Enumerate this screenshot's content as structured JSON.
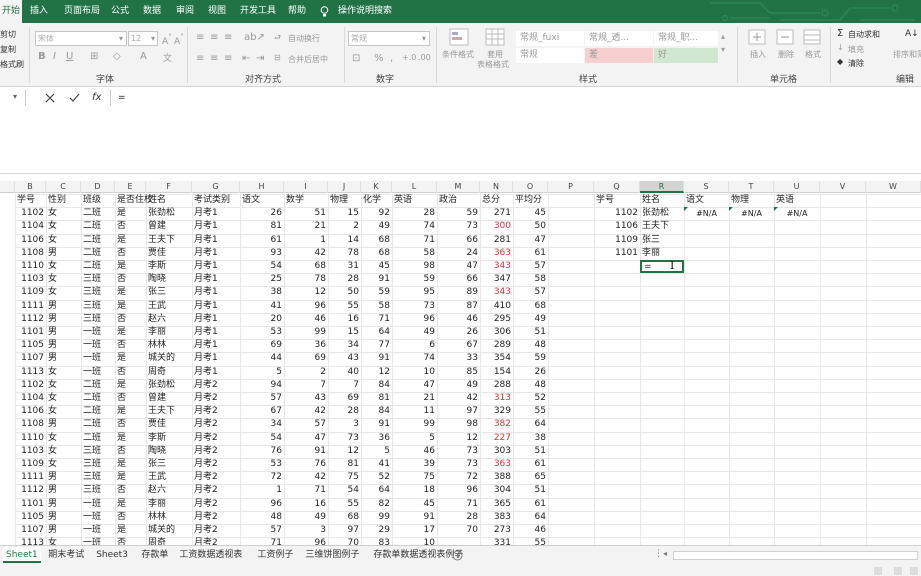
{
  "ribbon_tabs": [
    {
      "label": "开始",
      "active": true
    },
    {
      "label": "插入"
    },
    {
      "label": "页面布局"
    },
    {
      "label": "公式"
    },
    {
      "label": "数据"
    },
    {
      "label": "审阅"
    },
    {
      "label": "视图"
    },
    {
      "label": "开发工具"
    },
    {
      "label": "帮助"
    },
    {
      "label": "操作说明搜索"
    }
  ],
  "clipboard": {
    "cut": "剪切",
    "copy": "复制",
    "painter": "格式刷"
  },
  "font": {
    "name": "宋体",
    "size": "12",
    "group_label": "字体"
  },
  "alignment": {
    "wrap": "自动换行",
    "merge": "合并后居中",
    "group_label": "对齐方式"
  },
  "number": {
    "format": "常规",
    "group_label": "数字"
  },
  "styles": {
    "conditional": "条件格式",
    "table_format_1": "套用",
    "table_format_2": "表格格式",
    "cells": [
      "常规_fuxi",
      "常规_透...",
      "常规_职...",
      "常规",
      "差",
      "好"
    ],
    "group_label": "样式"
  },
  "cells_group": {
    "insert": "插入",
    "delete": "删除",
    "format": "格式",
    "group_label": "单元格"
  },
  "editing": {
    "autosum": "自动求和",
    "fill": "填充",
    "clear": "清除",
    "sort": "排序和筛",
    "group_label": "编辑"
  },
  "formula_bar": {
    "fx": "fx",
    "value": "="
  },
  "columns": [
    "B",
    "C",
    "D",
    "E",
    "F",
    "G",
    "H",
    "I",
    "J",
    "K",
    "L",
    "M",
    "N",
    "O",
    "P",
    "Q",
    "R",
    "S",
    "T",
    "U",
    "V",
    "W"
  ],
  "headers": [
    "学号",
    "性别",
    "班级",
    "是否住校",
    "姓名",
    "考试类别",
    "语文",
    "数学",
    "物理",
    "化学",
    "英语",
    "政治",
    "总分",
    "平均分"
  ],
  "rows": [
    [
      "1102",
      "女",
      "二班",
      "是",
      "张劲松",
      "月考1",
      "26",
      "51",
      "15",
      "92",
      "28",
      "59",
      "271",
      "45"
    ],
    [
      "1104",
      "女",
      "二班",
      "否",
      "曾建",
      "月考1",
      "81",
      "21",
      "2",
      "49",
      "74",
      "73",
      "300",
      "50"
    ],
    [
      "1106",
      "女",
      "二班",
      "是",
      "王夫下",
      "月考1",
      "61",
      "1",
      "14",
      "68",
      "71",
      "66",
      "281",
      "47"
    ],
    [
      "1108",
      "男",
      "二班",
      "否",
      "贾佳",
      "月考1",
      "93",
      "42",
      "78",
      "68",
      "58",
      "24",
      "363",
      "61"
    ],
    [
      "1110",
      "女",
      "二班",
      "是",
      "李斯",
      "月考1",
      "54",
      "68",
      "31",
      "45",
      "98",
      "47",
      "343",
      "57"
    ],
    [
      "1103",
      "女",
      "三班",
      "否",
      "陶晓",
      "月考1",
      "25",
      "78",
      "28",
      "91",
      "59",
      "66",
      "347",
      "58"
    ],
    [
      "1109",
      "女",
      "三班",
      "是",
      "张三",
      "月考1",
      "38",
      "12",
      "50",
      "59",
      "95",
      "89",
      "343",
      "57"
    ],
    [
      "1111",
      "男",
      "三班",
      "是",
      "王武",
      "月考1",
      "41",
      "96",
      "55",
      "58",
      "73",
      "87",
      "410",
      "68"
    ],
    [
      "1112",
      "男",
      "三班",
      "否",
      "赵六",
      "月考1",
      "20",
      "46",
      "16",
      "71",
      "96",
      "46",
      "295",
      "49"
    ],
    [
      "1101",
      "男",
      "一班",
      "是",
      "李丽",
      "月考1",
      "53",
      "99",
      "15",
      "64",
      "49",
      "26",
      "306",
      "51"
    ],
    [
      "1105",
      "男",
      "一班",
      "否",
      "林林",
      "月考1",
      "69",
      "36",
      "34",
      "77",
      "6",
      "67",
      "289",
      "48"
    ],
    [
      "1107",
      "男",
      "一班",
      "是",
      "城关的",
      "月考1",
      "44",
      "69",
      "43",
      "91",
      "74",
      "33",
      "354",
      "59"
    ],
    [
      "1113",
      "女",
      "一班",
      "否",
      "周奇",
      "月考1",
      "5",
      "2",
      "40",
      "12",
      "10",
      "85",
      "154",
      "26"
    ],
    [
      "1102",
      "女",
      "二班",
      "是",
      "张劲松",
      "月考2",
      "94",
      "7",
      "7",
      "84",
      "47",
      "49",
      "288",
      "48"
    ],
    [
      "1104",
      "女",
      "二班",
      "否",
      "曾建",
      "月考2",
      "57",
      "43",
      "69",
      "81",
      "21",
      "42",
      "313",
      "52"
    ],
    [
      "1106",
      "女",
      "二班",
      "是",
      "王夫下",
      "月考2",
      "67",
      "42",
      "28",
      "84",
      "11",
      "97",
      "329",
      "55"
    ],
    [
      "1108",
      "男",
      "二班",
      "否",
      "贾佳",
      "月考2",
      "34",
      "57",
      "3",
      "91",
      "99",
      "98",
      "382",
      "64"
    ],
    [
      "1110",
      "女",
      "二班",
      "是",
      "李斯",
      "月考2",
      "54",
      "47",
      "73",
      "36",
      "5",
      "12",
      "227",
      "38"
    ],
    [
      "1103",
      "女",
      "三班",
      "否",
      "陶晓",
      "月考2",
      "76",
      "91",
      "12",
      "5",
      "46",
      "73",
      "303",
      "51"
    ],
    [
      "1109",
      "女",
      "三班",
      "是",
      "张三",
      "月考2",
      "53",
      "76",
      "81",
      "41",
      "39",
      "73",
      "363",
      "61"
    ],
    [
      "1111",
      "男",
      "三班",
      "是",
      "王武",
      "月考2",
      "72",
      "42",
      "75",
      "52",
      "75",
      "72",
      "388",
      "65"
    ],
    [
      "1112",
      "男",
      "三班",
      "否",
      "赵六",
      "月考2",
      "1",
      "71",
      "54",
      "64",
      "18",
      "96",
      "304",
      "51"
    ],
    [
      "1101",
      "男",
      "一班",
      "是",
      "李丽",
      "月考2",
      "96",
      "16",
      "55",
      "82",
      "45",
      "71",
      "365",
      "61"
    ],
    [
      "1105",
      "男",
      "一班",
      "否",
      "林林",
      "月考2",
      "48",
      "49",
      "68",
      "99",
      "91",
      "28",
      "383",
      "64"
    ],
    [
      "1107",
      "男",
      "一班",
      "是",
      "城关的",
      "月考2",
      "57",
      "3",
      "97",
      "29",
      "17",
      "70",
      "273",
      "46"
    ],
    [
      "1113",
      "女",
      "一班",
      "否",
      "周奇",
      "月考2",
      "71",
      "96",
      "70",
      "83",
      "10",
      "",
      "331",
      "55"
    ]
  ],
  "red_totals": [
    "300",
    "363",
    "343",
    "313",
    "382",
    "227"
  ],
  "lookup": {
    "headers": [
      "学号",
      "姓名",
      "语文",
      "物理",
      "英语"
    ],
    "rows": [
      [
        "1102",
        "张劲松",
        "#N/A",
        "#N/A",
        "#N/A"
      ],
      [
        "1106",
        "王夫下",
        "",
        "",
        ""
      ],
      [
        "1109",
        "张三",
        "",
        "",
        ""
      ],
      [
        "1101",
        "李丽",
        "",
        "",
        ""
      ]
    ],
    "active_value": "="
  },
  "sheets": [
    {
      "label": "Sheet1",
      "active": true
    },
    {
      "label": "期末考试"
    },
    {
      "label": "Sheet3"
    },
    {
      "label": "存款单"
    },
    {
      "label": "工资数据透视表"
    },
    {
      "label": "工资例子"
    },
    {
      "label": "三维饼图例子"
    },
    {
      "label": "存款单数据透视表例子"
    }
  ]
}
